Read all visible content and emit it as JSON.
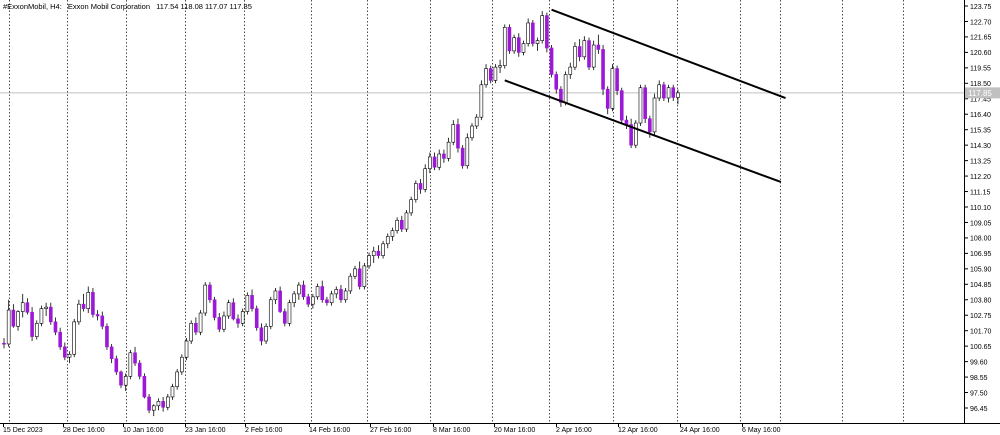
{
  "header": {
    "symbol_timeframe": "#ExxonMobil, H4:",
    "name": "Exxon Mobil Corporation",
    "ohlc": "117.54 118.08 117.07 117.85"
  },
  "price_tag": "117.85",
  "colors": {
    "background": "#ffffff",
    "bull_body": "#ffffff",
    "bear_body": "#9b19d6",
    "wick": "#000000",
    "grid": "#000000",
    "channel": "#000000",
    "price_line": "#c0c0c0"
  },
  "chart_data": {
    "type": "candlestick",
    "timeframe": "H4",
    "y_ticks": [
      "123.75",
      "122.70",
      "121.65",
      "120.60",
      "119.55",
      "118.50",
      "117.45",
      "116.40",
      "115.35",
      "114.30",
      "113.25",
      "112.20",
      "111.15",
      "110.10",
      "109.05",
      "108.00",
      "106.95",
      "105.90",
      "104.85",
      "103.80",
      "102.75",
      "101.70",
      "100.65",
      "99.60",
      "98.55",
      "97.50",
      "96.45"
    ],
    "ylim": [
      95.7,
      124.2
    ],
    "x_ticks": [
      "15 Dec 2023",
      "28 Dec 16:00",
      "10 Jan 16:00",
      "23 Jan 16:00",
      "2 Feb 16:00",
      "14 Feb 16:00",
      "27 Feb 16:00",
      "8 Mar 16:00",
      "20 Mar 16:00",
      "2 Apr 16:00",
      "12 Apr 16:00",
      "24 Apr 16:00",
      "6 May 16:00"
    ],
    "last_price": 117.85,
    "candles_ohlc": [
      [
        100.85,
        101.2,
        100.5,
        100.8
      ],
      [
        100.8,
        103.8,
        100.6,
        103.1
      ],
      [
        103.1,
        103.5,
        101.9,
        102.0
      ],
      [
        102.0,
        103.1,
        101.7,
        103.0
      ],
      [
        103.0,
        104.2,
        102.6,
        103.6
      ],
      [
        103.6,
        103.9,
        102.8,
        102.95
      ],
      [
        102.95,
        103.3,
        101.0,
        101.3
      ],
      [
        101.3,
        102.4,
        101.1,
        102.2
      ],
      [
        102.2,
        103.4,
        102.0,
        103.2
      ],
      [
        103.2,
        103.6,
        102.7,
        103.3
      ],
      [
        103.3,
        103.6,
        102.1,
        102.3
      ],
      [
        102.3,
        102.6,
        101.4,
        101.6
      ],
      [
        101.6,
        101.9,
        100.4,
        100.6
      ],
      [
        100.6,
        100.9,
        99.7,
        99.9
      ],
      [
        99.9,
        100.3,
        99.5,
        100.1
      ],
      [
        100.1,
        102.5,
        99.9,
        102.3
      ],
      [
        102.3,
        103.8,
        102.1,
        103.5
      ],
      [
        103.5,
        104.2,
        103.0,
        103.2
      ],
      [
        103.2,
        104.7,
        102.9,
        104.3
      ],
      [
        104.3,
        104.6,
        102.6,
        102.8
      ],
      [
        102.8,
        103.1,
        102.4,
        102.7
      ],
      [
        102.7,
        103.0,
        101.8,
        102.0
      ],
      [
        102.0,
        102.2,
        100.4,
        100.6
      ],
      [
        100.6,
        100.8,
        99.5,
        99.8
      ],
      [
        99.8,
        100.0,
        98.7,
        98.9
      ],
      [
        98.9,
        99.0,
        97.8,
        98.0
      ],
      [
        98.0,
        98.8,
        97.6,
        98.6
      ],
      [
        98.6,
        100.4,
        98.4,
        100.2
      ],
      [
        100.2,
        100.6,
        99.3,
        99.5
      ],
      [
        99.5,
        99.7,
        98.4,
        98.6
      ],
      [
        98.6,
        98.8,
        97.1,
        97.2
      ],
      [
        97.2,
        97.4,
        96.1,
        96.3
      ],
      [
        96.3,
        96.7,
        95.9,
        96.6
      ],
      [
        96.6,
        97.1,
        96.3,
        96.9
      ],
      [
        96.9,
        97.2,
        96.2,
        96.5
      ],
      [
        96.5,
        97.4,
        96.3,
        97.2
      ],
      [
        97.2,
        98.1,
        97.0,
        97.9
      ],
      [
        97.9,
        99.1,
        97.7,
        98.9
      ],
      [
        98.9,
        100.1,
        98.7,
        99.9
      ],
      [
        99.9,
        101.2,
        99.7,
        101.0
      ],
      [
        101.0,
        102.4,
        100.8,
        102.2
      ],
      [
        102.2,
        102.6,
        101.4,
        101.6
      ],
      [
        101.6,
        103.1,
        101.4,
        102.9
      ],
      [
        102.9,
        105.0,
        102.7,
        104.8
      ],
      [
        104.8,
        105.0,
        103.6,
        103.8
      ],
      [
        103.8,
        104.0,
        102.4,
        102.6
      ],
      [
        102.6,
        102.9,
        101.6,
        101.8
      ],
      [
        101.8,
        103.0,
        101.6,
        102.7
      ],
      [
        102.7,
        103.8,
        102.5,
        103.6
      ],
      [
        103.6,
        103.9,
        102.4,
        102.5
      ],
      [
        102.5,
        102.8,
        101.9,
        102.2
      ],
      [
        102.2,
        103.2,
        102.0,
        103.0
      ],
      [
        103.0,
        104.3,
        102.8,
        104.1
      ],
      [
        104.1,
        104.5,
        103.0,
        103.2
      ],
      [
        103.2,
        103.4,
        101.7,
        101.9
      ],
      [
        101.9,
        102.2,
        100.7,
        101.0
      ],
      [
        101.0,
        102.2,
        100.8,
        102.0
      ],
      [
        102.0,
        104.0,
        101.8,
        103.8
      ],
      [
        103.8,
        104.6,
        103.5,
        104.4
      ],
      [
        104.4,
        104.7,
        102.9,
        103.0
      ],
      [
        103.0,
        103.2,
        102.0,
        102.2
      ],
      [
        102.2,
        103.8,
        102.0,
        103.6
      ],
      [
        103.6,
        104.4,
        103.3,
        104.2
      ],
      [
        104.2,
        105.0,
        103.8,
        104.8
      ],
      [
        104.8,
        105.1,
        103.8,
        104.0
      ],
      [
        104.0,
        104.2,
        103.3,
        103.5
      ],
      [
        103.5,
        104.2,
        103.2,
        104.0
      ],
      [
        104.0,
        104.9,
        103.8,
        104.7
      ],
      [
        104.7,
        105.1,
        103.6,
        103.8
      ],
      [
        103.8,
        104.0,
        103.4,
        103.6
      ],
      [
        103.6,
        104.4,
        103.4,
        104.2
      ],
      [
        104.2,
        104.7,
        103.9,
        104.5
      ],
      [
        104.5,
        104.8,
        103.6,
        103.8
      ],
      [
        103.8,
        104.6,
        103.6,
        104.4
      ],
      [
        104.4,
        105.6,
        104.2,
        105.4
      ],
      [
        105.4,
        106.1,
        105.2,
        105.9
      ],
      [
        105.9,
        106.4,
        104.5,
        104.7
      ],
      [
        104.7,
        106.3,
        104.5,
        106.1
      ],
      [
        106.1,
        107.0,
        105.9,
        106.8
      ],
      [
        106.8,
        107.4,
        106.3,
        107.1
      ],
      [
        107.1,
        107.5,
        106.6,
        106.8
      ],
      [
        106.8,
        107.8,
        106.6,
        107.6
      ],
      [
        107.6,
        108.3,
        107.3,
        108.1
      ],
      [
        108.1,
        108.7,
        107.8,
        108.5
      ],
      [
        108.5,
        109.4,
        108.3,
        109.2
      ],
      [
        109.2,
        109.5,
        108.4,
        108.6
      ],
      [
        108.6,
        109.9,
        108.4,
        109.7
      ],
      [
        109.7,
        110.8,
        109.5,
        110.6
      ],
      [
        110.6,
        111.9,
        110.4,
        111.7
      ],
      [
        111.7,
        112.0,
        111.0,
        111.3
      ],
      [
        111.3,
        113.0,
        111.1,
        112.7
      ],
      [
        112.7,
        113.8,
        112.4,
        113.5
      ],
      [
        113.5,
        113.8,
        112.6,
        112.8
      ],
      [
        112.8,
        114.0,
        112.6,
        113.7
      ],
      [
        113.7,
        114.0,
        113.1,
        113.4
      ],
      [
        113.4,
        114.8,
        113.2,
        114.5
      ],
      [
        114.5,
        116.0,
        114.3,
        115.7
      ],
      [
        115.7,
        116.1,
        113.8,
        114.1
      ],
      [
        114.1,
        114.3,
        112.7,
        112.9
      ],
      [
        112.9,
        115.1,
        112.7,
        114.8
      ],
      [
        114.8,
        115.8,
        114.6,
        115.6
      ],
      [
        115.6,
        116.4,
        115.4,
        116.2
      ],
      [
        116.2,
        118.7,
        116.0,
        118.4
      ],
      [
        118.4,
        119.8,
        118.2,
        119.5
      ],
      [
        119.5,
        119.7,
        118.5,
        118.7
      ],
      [
        118.7,
        119.8,
        118.5,
        119.6
      ],
      [
        119.6,
        120.1,
        119.2,
        119.7
      ],
      [
        119.7,
        122.5,
        119.5,
        122.3
      ],
      [
        122.3,
        122.5,
        120.5,
        120.7
      ],
      [
        120.7,
        121.8,
        120.5,
        121.6
      ],
      [
        121.6,
        121.9,
        120.3,
        120.6
      ],
      [
        120.6,
        121.4,
        120.4,
        121.2
      ],
      [
        121.2,
        122.9,
        121.0,
        122.6
      ],
      [
        122.6,
        122.8,
        121.0,
        121.2
      ],
      [
        121.2,
        121.6,
        120.7,
        121.4
      ],
      [
        121.4,
        123.4,
        121.2,
        123.1
      ],
      [
        123.1,
        123.3,
        120.6,
        120.9
      ],
      [
        120.9,
        121.1,
        118.9,
        119.1
      ],
      [
        119.1,
        119.3,
        117.8,
        118.1
      ],
      [
        118.1,
        118.3,
        116.9,
        117.2
      ],
      [
        117.2,
        119.3,
        117.0,
        119.1
      ],
      [
        119.1,
        119.9,
        118.8,
        119.6
      ],
      [
        119.6,
        121.3,
        119.4,
        121.0
      ],
      [
        121.0,
        121.5,
        120.0,
        120.3
      ],
      [
        120.3,
        121.7,
        120.1,
        121.4
      ],
      [
        121.4,
        121.6,
        119.4,
        119.6
      ],
      [
        119.6,
        121.4,
        119.4,
        121.1
      ],
      [
        121.1,
        121.8,
        120.5,
        120.8
      ],
      [
        120.8,
        121.1,
        117.7,
        118.1
      ],
      [
        118.1,
        118.3,
        116.4,
        116.8
      ],
      [
        116.8,
        119.8,
        116.6,
        119.5
      ],
      [
        119.5,
        119.7,
        117.7,
        118.0
      ],
      [
        118.0,
        118.2,
        115.7,
        116.0
      ],
      [
        116.0,
        116.3,
        115.4,
        115.7
      ],
      [
        115.7,
        116.1,
        114.1,
        114.3
      ],
      [
        114.3,
        116.0,
        114.1,
        115.8
      ],
      [
        115.8,
        118.4,
        115.6,
        118.2
      ],
      [
        118.2,
        118.4,
        115.8,
        116.1
      ],
      [
        116.1,
        116.3,
        114.8,
        115.2
      ],
      [
        115.2,
        117.8,
        115.0,
        117.5
      ],
      [
        117.5,
        118.7,
        117.3,
        118.4
      ],
      [
        118.4,
        118.6,
        117.3,
        117.5
      ],
      [
        117.5,
        118.4,
        117.2,
        118.2
      ],
      [
        118.2,
        118.4,
        117.3,
        117.54
      ],
      [
        117.54,
        118.08,
        117.07,
        117.85
      ]
    ],
    "channel": {
      "upper": {
        "from": {
          "candle": 117,
          "price": 123.5
        },
        "to": {
          "candle": 167,
          "price": 117.5
        }
      },
      "lower": {
        "from": {
          "candle": 107,
          "price": 118.7
        },
        "to": {
          "candle": 166,
          "price": 111.8
        }
      }
    }
  }
}
